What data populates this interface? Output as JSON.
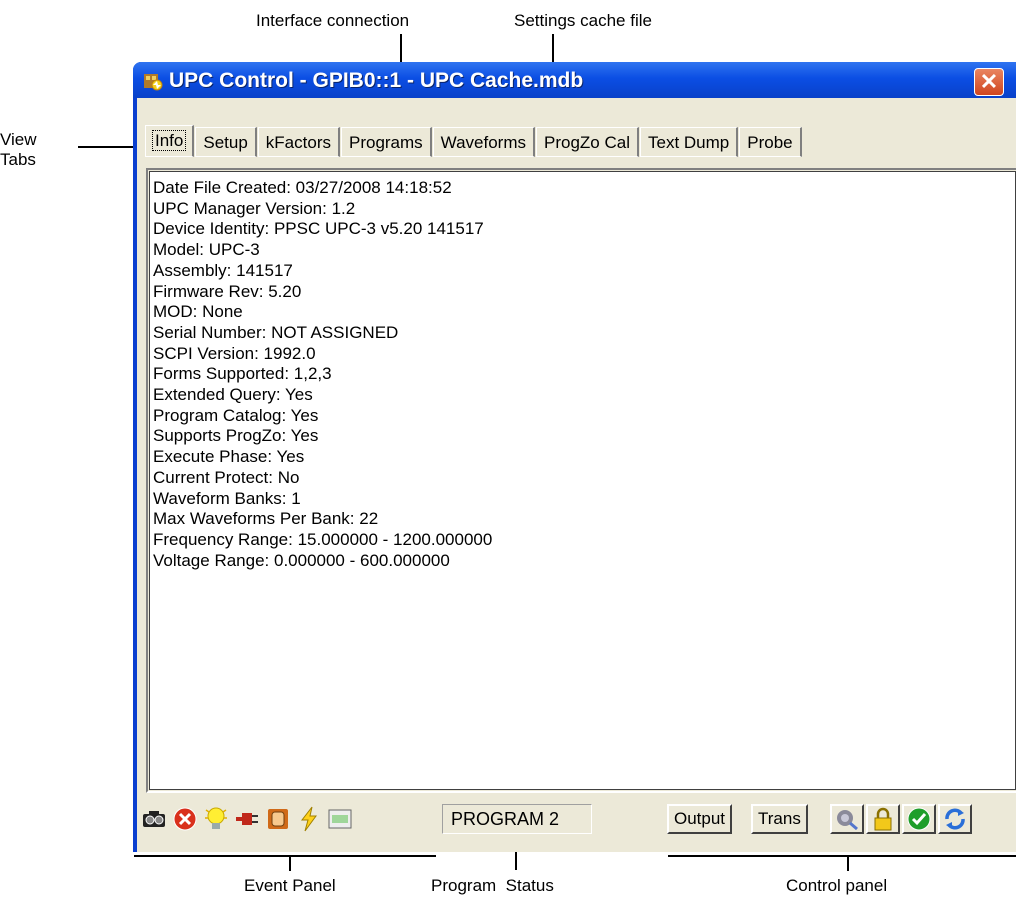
{
  "annotations": {
    "interface_connection": "Interface connection",
    "settings_cache_file": "Settings cache file",
    "view_tabs_line1": "View",
    "view_tabs_line2": "Tabs",
    "event_panel": "Event Panel",
    "program_status": "Program  Status",
    "control_panel": "Control panel"
  },
  "window": {
    "title": "UPC Control - GPIB0::1 - UPC Cache.mdb",
    "close_glyph": "✕"
  },
  "tabs": [
    {
      "label": "Info",
      "selected": true
    },
    {
      "label": "Setup"
    },
    {
      "label": "kFactors"
    },
    {
      "label": "Programs"
    },
    {
      "label": "Waveforms"
    },
    {
      "label": "ProgZo Cal"
    },
    {
      "label": "Text Dump"
    },
    {
      "label": "Probe"
    }
  ],
  "info_lines": [
    "Date File Created: 03/27/2008 14:18:52",
    "UPC Manager Version: 1.2",
    "Device Identity: PPSC UPC-3 v5.20 141517",
    "Model: UPC-3",
    "Assembly: 141517",
    "Firmware Rev: 5.20",
    "MOD: None",
    "Serial Number: NOT ASSIGNED",
    "SCPI Version: 1992.0",
    "Forms Supported: 1,2,3",
    "Extended Query: Yes",
    "Program Catalog: Yes",
    "Supports ProgZo: Yes",
    "Execute Phase: Yes",
    "Current Protect: No",
    "Waveform Banks: 1",
    "Max Waveforms Per Bank: 22",
    "Frequency Range: 15.000000 - 1200.000000",
    "Voltage Range: 0.000000 - 600.000000"
  ],
  "status_bar": {
    "event_icons": [
      "camera-icon",
      "error-icon",
      "lightbulb-icon",
      "plug-icon",
      "hand-icon",
      "lightning-icon",
      "window-icon"
    ],
    "program_status": "PROGRAM 2",
    "output_label": "Output",
    "trans_label": "Trans",
    "control_icons": [
      "probe-icon",
      "lock-icon",
      "check-icon",
      "refresh-icon"
    ]
  },
  "colors": {
    "titlebar": "#0b4ee4",
    "window_face": "#ece9d8",
    "close_button": "#d0451f"
  }
}
